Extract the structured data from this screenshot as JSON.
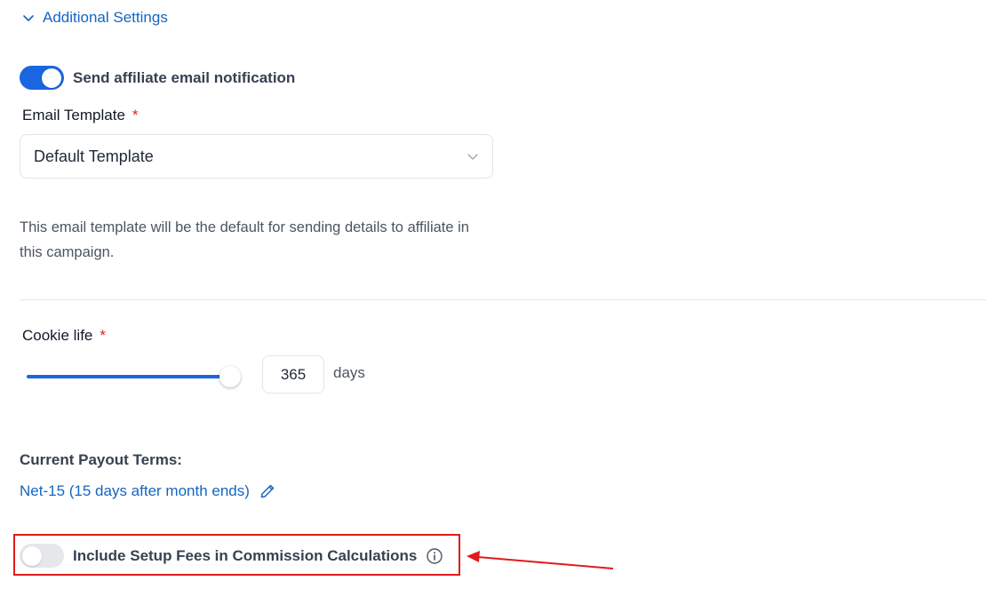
{
  "section": {
    "title": "Additional Settings",
    "expanded": true
  },
  "email_notification": {
    "label": "Send affiliate email notification",
    "enabled": true
  },
  "email_template": {
    "label": "Email Template",
    "required_mark": "*",
    "selected": "Default Template",
    "help_text": "This email template will be the default for sending details to affiliate in this campaign."
  },
  "cookie_life": {
    "label": "Cookie life",
    "required_mark": "*",
    "value": "365",
    "unit": "days",
    "slider_fraction": 1.0
  },
  "payout": {
    "label": "Current Payout Terms:",
    "value": "Net-15 (15 days after month ends)"
  },
  "setup_fees": {
    "label": "Include Setup Fees in Commission Calculations",
    "enabled": false
  },
  "colors": {
    "accent": "#1a66e0",
    "link": "#1565c0",
    "required": "#dc2626",
    "annotation": "#e01b1b"
  },
  "icons": [
    "chevron-down-icon",
    "pencil-icon",
    "info-icon",
    "arrow-annotation"
  ]
}
